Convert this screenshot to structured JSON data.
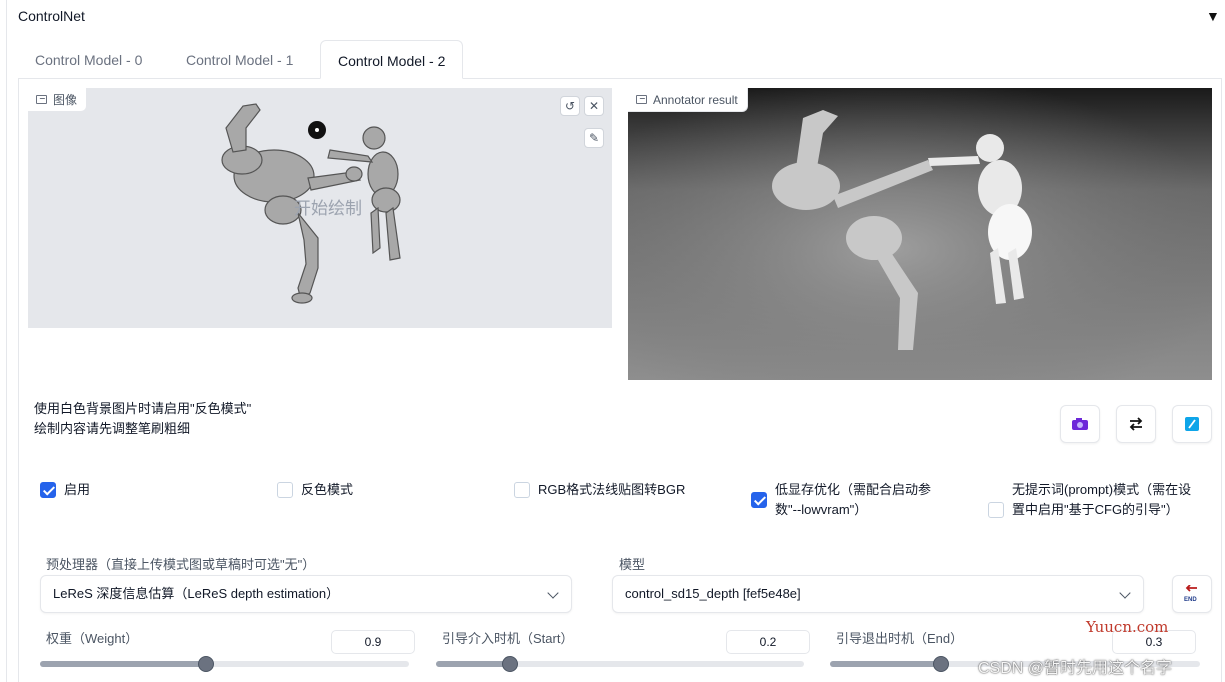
{
  "accordion": {
    "title": "ControlNet",
    "toggle_icon": "▼"
  },
  "tabs": [
    {
      "label": "Control Model - 0",
      "active": false
    },
    {
      "label": "Control Model - 1",
      "active": false
    },
    {
      "label": "Control Model - 2",
      "active": true
    }
  ],
  "image_panel": {
    "label": "图像",
    "watermark_text": "开始绘制",
    "icon": "image-icon"
  },
  "annotator_panel": {
    "label": "Annotator result",
    "icon": "image-icon"
  },
  "hints": {
    "line1": "使用白色背景图片时请启用\"反色模式\"",
    "line2": "绘制内容请先调整笔刷粗细"
  },
  "action_buttons": [
    {
      "name": "camera-button",
      "icon": "camera-icon"
    },
    {
      "name": "swap-button",
      "icon": "swap-icon"
    },
    {
      "name": "send-dimensions-button",
      "icon": "straight-ruler-icon"
    }
  ],
  "checkboxes": [
    {
      "label": "启用",
      "checked": true
    },
    {
      "label": "反色模式",
      "checked": false
    },
    {
      "label": "RGB格式法线贴图转BGR",
      "checked": false
    },
    {
      "label": "低显存优化（需配合启动参数\"--lowvram\"）",
      "checked": true
    },
    {
      "label": "无提示词(prompt)模式（需在设置中启用\"基于CFG的引导\"）",
      "checked": false
    }
  ],
  "preprocessor": {
    "label": "预处理器（直接上传模式图或草稿时可选\"无\"）",
    "value": "LeReS 深度信息估算（LeReS depth estimation）"
  },
  "model": {
    "label": "模型",
    "value": "control_sd15_depth [fef5e48e]",
    "refresh_icon": "end-refresh-icon"
  },
  "sliders": [
    {
      "label": "权重（Weight）",
      "value": "0.9",
      "fraction": 0.45
    },
    {
      "label": "引导介入时机（Start）",
      "value": "0.2",
      "fraction": 0.2
    },
    {
      "label": "引导退出时机（End）",
      "value": "0.3",
      "fraction": 0.3
    }
  ],
  "watermarks": {
    "site": "Yuucn.com",
    "csdn": "CSDN @暂时先用这个名字"
  },
  "colors": {
    "accent": "#2563eb",
    "panel_bg": "#e5e7eb",
    "border": "#e5e7eb"
  }
}
